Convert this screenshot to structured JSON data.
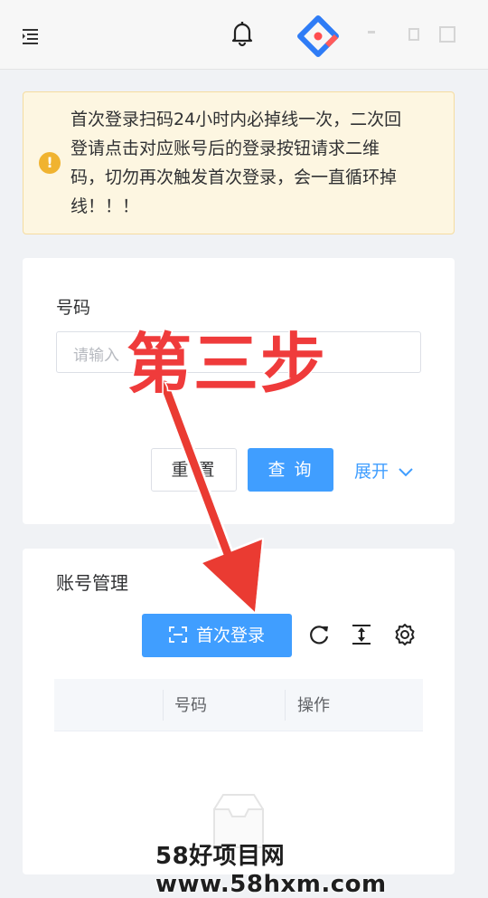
{
  "alert": {
    "text": "首次登录扫码24小时内必掉线一次，二次回\n登请点击对应账号后的登录按钮请求二维\n码，切勿再次触发首次登录，会一直循环掉\n线！！！"
  },
  "search": {
    "field_label": "号码",
    "input_placeholder": "请输入",
    "reset_label": "重 置",
    "query_label": "查 询",
    "expand_label": "展开"
  },
  "list": {
    "title": "账号管理",
    "first_login_label": "首次登录",
    "columns": [
      "号码",
      "操作"
    ]
  },
  "overlay": {
    "step_text": "第三步",
    "color": "#ef3b3b"
  },
  "watermark": "58好项目网www.58hxm.com",
  "colors": {
    "primary": "#409eff",
    "warning": "#f0b330"
  }
}
